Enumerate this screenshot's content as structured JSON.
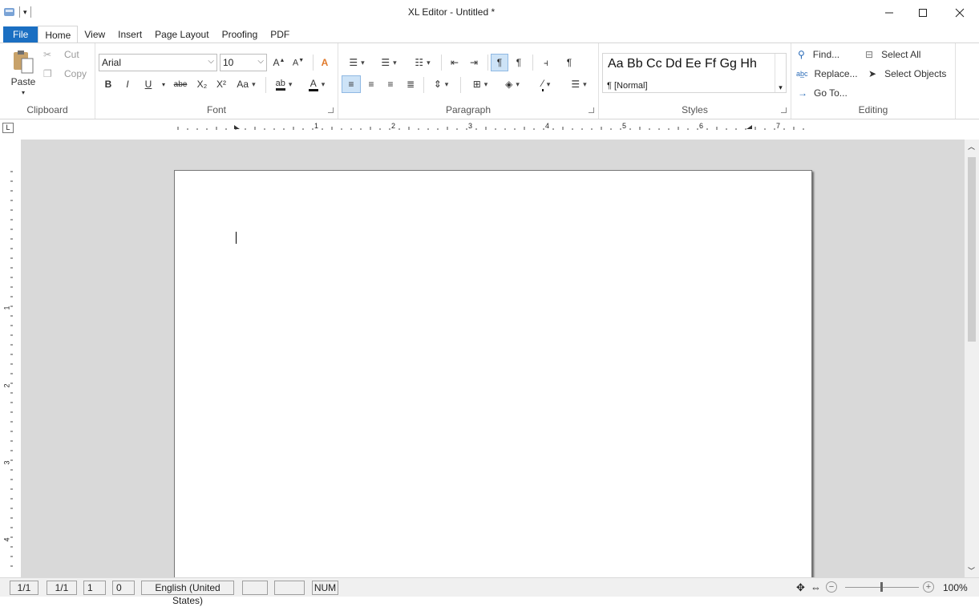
{
  "window": {
    "title": "XL Editor - Untitled *"
  },
  "tabs": [
    "File",
    "Home",
    "View",
    "Insert",
    "Page Layout",
    "Proofing",
    "PDF"
  ],
  "clipboard": {
    "paste": "Paste",
    "cut": "Cut",
    "copy": "Copy",
    "label": "Clipboard"
  },
  "font": {
    "name": "Arial",
    "size": "10",
    "label": "Font",
    "bold": "B",
    "italic": "I",
    "underline": "U",
    "strike": "abe",
    "sub": "X₂",
    "sup": "X²",
    "case": "Aa",
    "font_color": "A"
  },
  "paragraph": {
    "label": "Paragraph",
    "show_marks": "¶"
  },
  "styles": {
    "preview": "Aa Bb Cc Dd Ee Ff Gg Hh",
    "current": "¶ [Normal]",
    "label": "Styles"
  },
  "editing": {
    "find": "Find...",
    "replace": "Replace...",
    "goto": "Go To...",
    "select_all": "Select All",
    "select_objects": "Select Objects",
    "label": "Editing"
  },
  "ruler": {
    "marks": [
      "1",
      "2",
      "3",
      "4",
      "5",
      "6",
      "7"
    ],
    "vmarks": [
      "1",
      "2",
      "3",
      "4"
    ]
  },
  "status": {
    "page": "1/1",
    "section": "1/1",
    "line": "1",
    "col": "0",
    "language": "English (United States)",
    "num": "NUM",
    "zoom": "100%"
  },
  "colors": {
    "file_tab": "#1b6fc2",
    "workspace": "#d9d9d9",
    "accent": "#2b6cb8"
  }
}
